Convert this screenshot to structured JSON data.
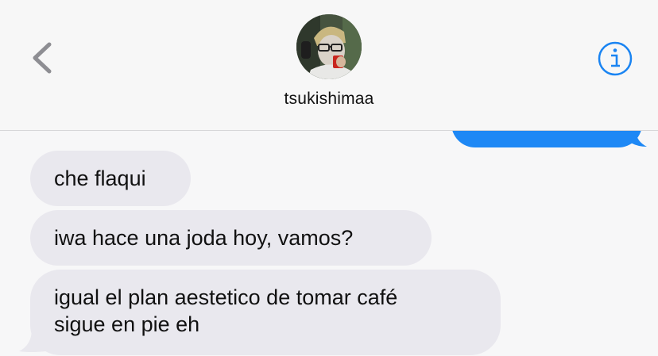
{
  "header": {
    "contact_name": "tsukishimaa",
    "back_icon": "chevron-left-icon",
    "info_icon": "info-circle-icon",
    "accent_color": "#1a84f2"
  },
  "thread": {
    "sent_bubble_color": "#1e88f5",
    "received_bubble_color": "#e9e8ee",
    "messages": [
      {
        "direction": "received",
        "text": "che flaqui"
      },
      {
        "direction": "received",
        "text": "iwa hace una joda hoy, vamos?"
      },
      {
        "direction": "received",
        "text": "igual el plan aestetico de tomar café\nsigue en pie eh"
      }
    ]
  }
}
